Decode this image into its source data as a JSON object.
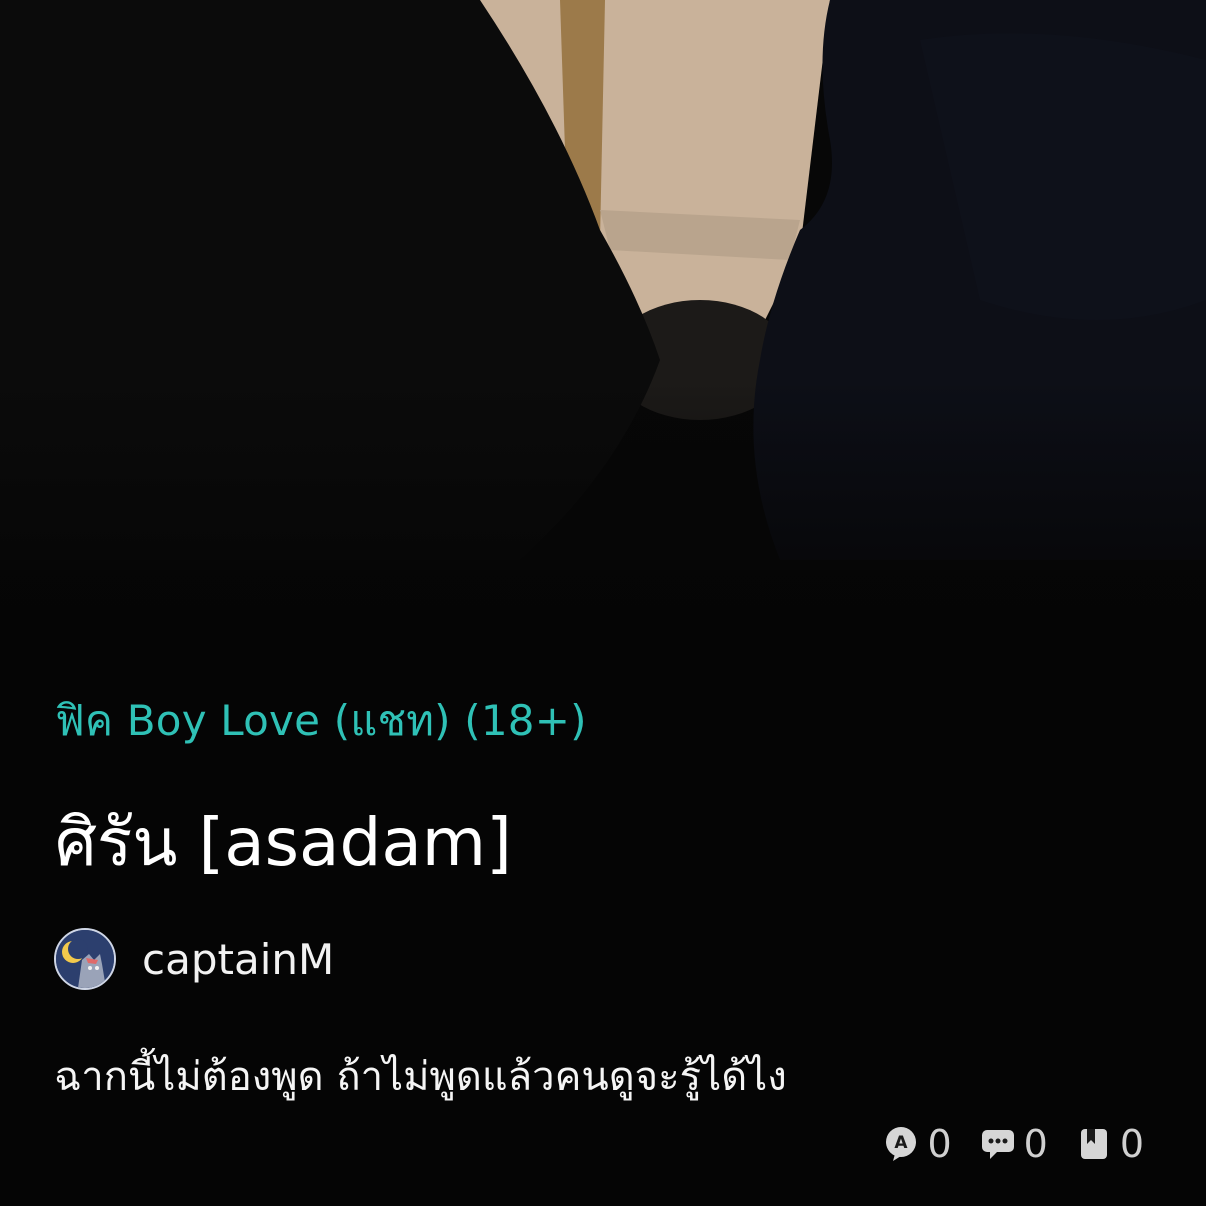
{
  "story": {
    "category": "ฟิค Boy Love (แชท) (18+)",
    "title": "ศิรัน [asadam]",
    "description": "ฉากนี้ไม่ต้องพูด ถ้าไม่พูดแล้วคนดูจะรู้ได้ไง"
  },
  "author": {
    "name": "captainM",
    "avatar_icon": "cat-moon-avatar"
  },
  "stats": {
    "views": {
      "icon": "read-icon",
      "count": "0"
    },
    "comments": {
      "icon": "comment-icon",
      "count": "0"
    },
    "bookmarks": {
      "icon": "bookmark-icon",
      "count": "0"
    }
  },
  "colors": {
    "category": "#2fc1b6",
    "background": "#050505"
  }
}
